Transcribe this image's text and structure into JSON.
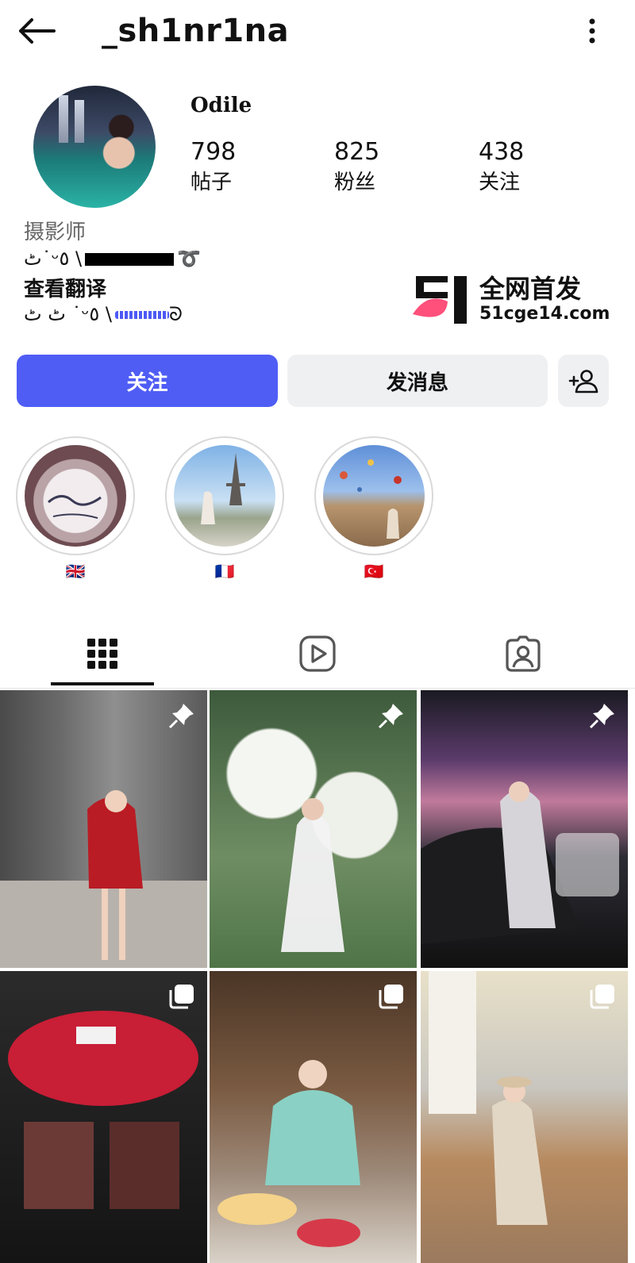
{
  "header": {
    "username": "_sh1nr1na",
    "back_icon": "arrow-left-icon",
    "more_icon": "more-vertical-icon"
  },
  "profile": {
    "display_name": "Odile",
    "stats": [
      {
        "value": "798",
        "label": "帖子"
      },
      {
        "value": "825",
        "label": "粉丝"
      },
      {
        "value": "438",
        "label": "关注"
      }
    ],
    "role": "摄影师",
    "bio_line1_start": "ٹ˙ᵕ٥ \\",
    "bio_line1_end": "➰",
    "translate_link": "查看翻译",
    "bio_line2_start": "ٹ ٹ   ˙ᵕ٥ \\",
    "bio_line2_end": "ᘐ"
  },
  "watermark": {
    "title": "全网首发",
    "url": "51cge14.com"
  },
  "actions": {
    "follow_label": "关注",
    "message_label": "发消息",
    "add_user_icon": "add-user-icon"
  },
  "highlights": [
    {
      "label": "🇬🇧",
      "theme": "odile-cup"
    },
    {
      "label": "🇫🇷",
      "theme": "eiffel-tower"
    },
    {
      "label": "🇹🇷",
      "theme": "cappadocia-balloons"
    }
  ],
  "tabs": [
    {
      "name": "grid-tab",
      "icon": "grid-icon",
      "active": true
    },
    {
      "name": "reels-tab",
      "icon": "play-icon",
      "active": false
    },
    {
      "name": "tagged-tab",
      "icon": "tagged-user-icon",
      "active": false
    }
  ],
  "posts": [
    {
      "badge": "pin-icon",
      "scene": "red-dress-interior"
    },
    {
      "badge": "pin-icon",
      "scene": "white-dress-flowers"
    },
    {
      "badge": "pin-icon",
      "scene": "night-car-city"
    },
    {
      "badge": "multiple-icon",
      "scene": "roses-bouquet"
    },
    {
      "badge": "multiple-icon",
      "scene": "teal-sweater-tea"
    },
    {
      "badge": "multiple-icon",
      "scene": "terrace-hat"
    }
  ],
  "colors": {
    "accent": "#4f5df5",
    "secondary_button": "#eff0f2",
    "text": "#111111",
    "muted": "#666666"
  }
}
